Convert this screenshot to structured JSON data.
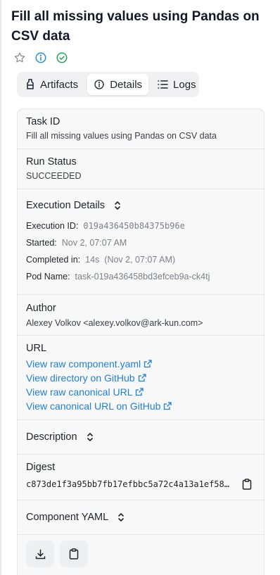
{
  "page": {
    "title": "Fill all missing values using Pandas on CSV data"
  },
  "tabs": [
    {
      "label": "Artifacts"
    },
    {
      "label": "Details"
    },
    {
      "label": "Logs"
    }
  ],
  "details": {
    "task_id_label": "Task ID",
    "task_id_value": "Fill all missing values using Pandas on CSV data",
    "run_status_label": "Run Status",
    "run_status_value": "SUCCEEDED",
    "execution_details_label": "Execution Details",
    "execution": {
      "id_label": "Execution ID:",
      "id_value": "019a436450b84375b96e",
      "started_label": "Started:",
      "started_value": "Nov 2, 07:07 AM",
      "completed_label": "Completed in:",
      "completed_duration": "14s",
      "completed_time": "(Nov 2, 07:07 AM)",
      "pod_label": "Pod Name:",
      "pod_value": "task-019a436458bd3efceb9a-ck4tj"
    },
    "author_label": "Author",
    "author_value": "Alexey Volkov <alexey.volkov@ark-kun.com>",
    "url_label": "URL",
    "urls": [
      {
        "text": "View raw component.yaml"
      },
      {
        "text": "View directory on GitHub"
      },
      {
        "text": "View raw canonical URL"
      },
      {
        "text": "View canonical URL on GitHub"
      }
    ],
    "description_label": "Description",
    "digest_label": "Digest",
    "digest_value": "c873de1f3a95bb7fb17efbbc5a72c4a13a1ef58…",
    "component_yaml_label": "Component YAML"
  },
  "icons": {
    "star": "star-icon",
    "info": "info-icon",
    "check": "check-circle-icon",
    "copy": "clipboard-icon",
    "download": "download-icon",
    "external": "external-link-icon",
    "chevron": "chevron-up-down-icon"
  },
  "colors": {
    "link": "#1e7fd6",
    "info": "#2a8bd8",
    "success": "#22a45a"
  }
}
